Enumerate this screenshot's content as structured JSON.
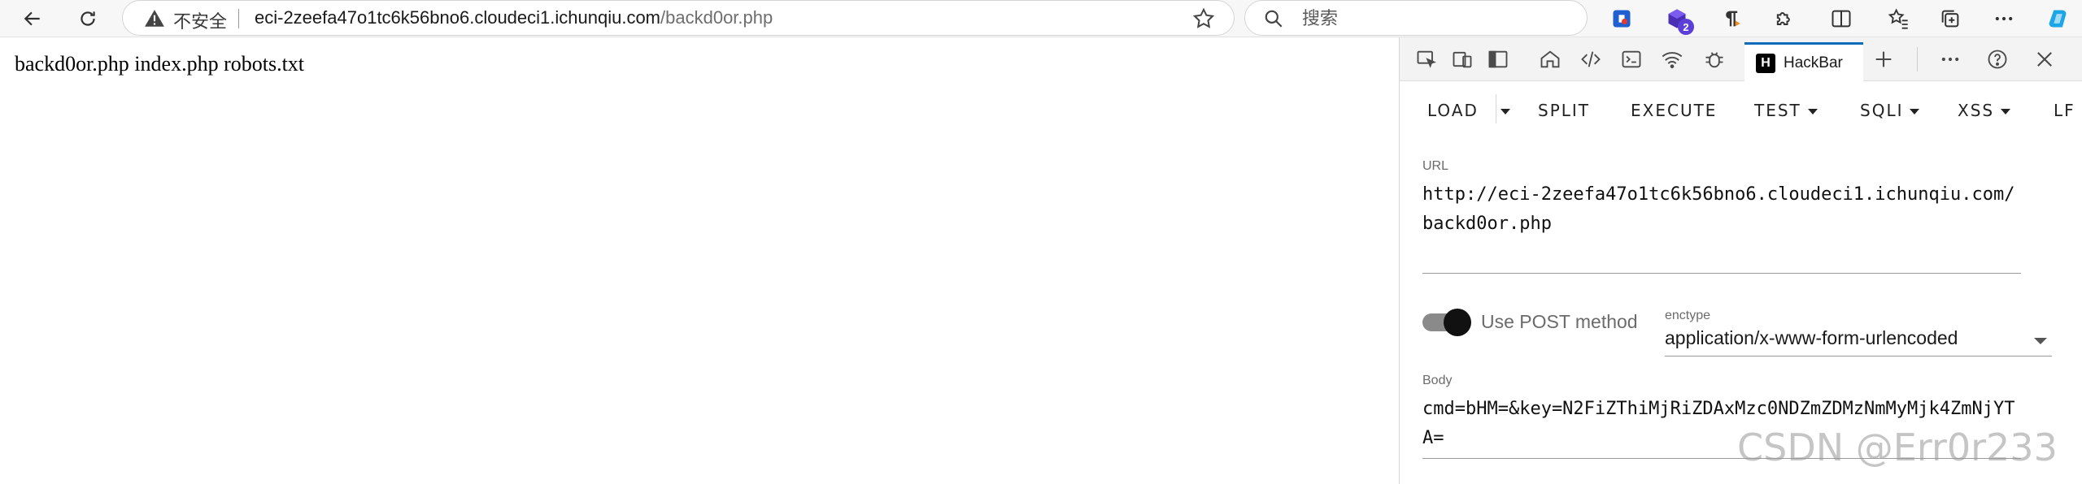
{
  "browser": {
    "insecure_label": "不安全",
    "url_host": "eci-2zeefa47o1tc6k56bno6.cloudeci1.ichunqiu.com",
    "url_path": "/backd0or.php",
    "search_placeholder": "搜索",
    "extension_badge": "2"
  },
  "page": {
    "listing": "backd0or.php index.php robots.txt"
  },
  "devtools": {
    "active_tab": "HackBar",
    "hackbar_logo": "H"
  },
  "hackbar": {
    "menu": {
      "load": "LOAD",
      "split": "SPLIT",
      "execute": "EXECUTE",
      "test": "TEST",
      "sqli": "SQLI",
      "xss": "XSS",
      "lfi": "LF"
    },
    "url_label": "URL",
    "url_value": "http://eci-2zeefa47o1tc6k56bno6.cloudeci1.ichunqiu.com/backd0or.php",
    "post_label": "Use POST method",
    "post_enabled": true,
    "enctype_label": "enctype",
    "enctype_value": "application/x-www-form-urlencoded",
    "body_label": "Body",
    "body_value": "cmd=bHM=&key=N2FiZThiMjRiZDAxMzc0NDZmZDMzNmMyMjk4ZmNjYTA="
  },
  "watermark": "CSDN @Err0r233",
  "colors": {
    "active_tab_accent": "#0f6cbd",
    "extension_badge": "#5b3fd8",
    "copilot": "#1ba6e8"
  }
}
